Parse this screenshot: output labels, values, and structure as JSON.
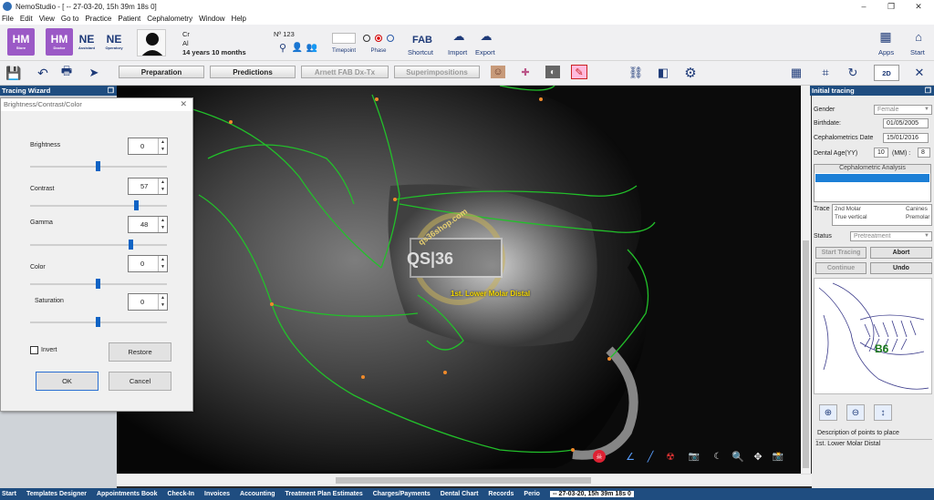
{
  "window": {
    "title": "NemoStudio - [ -- 27-03-20, 15h 39m 18s 0]",
    "minimize": "–",
    "maximize": "❐",
    "close": "✕"
  },
  "menu": [
    "File",
    "Edit",
    "View",
    "Go to",
    "Practice",
    "Patient",
    "Cephalometry",
    "Window",
    "Help"
  ],
  "toolbar": {
    "hm1": {
      "big": "HM",
      "small": "Store"
    },
    "hm2": {
      "big": "HM",
      "small": "Doctor"
    },
    "ne1": {
      "big": "NE",
      "small": "Assistant"
    },
    "ne2": {
      "big": "NE",
      "small": "Operatory"
    },
    "patient": {
      "line1": "Cr",
      "line2": "Al",
      "age": "14 years 10 months",
      "number": "Nº 123"
    },
    "timepoint": "Timepoint",
    "phase": "Phase",
    "fab": {
      "big": "FAB",
      "label": "Shortcut"
    },
    "import": "Import",
    "export": "Export",
    "apps": "Apps",
    "start": "Start"
  },
  "toolbar2": {
    "preparation": "Preparation",
    "predictions": "Predictions",
    "arnett": "Arnett FAB Dx-Tx",
    "superimpositions": "Superimpositions",
    "view2d": "2D"
  },
  "left_panel": {
    "title": "Tracing Wizard"
  },
  "dialog": {
    "title": "Brightness/Contrast/Color",
    "close": "✕",
    "fields": [
      {
        "label": "Brightness",
        "value": "0",
        "slider": 0.5
      },
      {
        "label": "Contrast",
        "value": "57",
        "slider": 0.78
      },
      {
        "label": "Gamma",
        "value": "48",
        "slider": 0.74
      },
      {
        "label": "Color",
        "value": "0",
        "slider": 0.5
      },
      {
        "label": "Saturation",
        "value": "0",
        "slider": 0.5
      }
    ],
    "invert": "Invert",
    "restore": "Restore",
    "ok": "OK",
    "cancel": "Cancel"
  },
  "xray": {
    "label": "1st. Lower Molar Distal",
    "watermark": "qs36shop.com"
  },
  "right_panel": {
    "title": "Initial tracing",
    "gender_label": "Gender",
    "gender": "Female",
    "birthdate_label": "Birthdate:",
    "birthdate": "01/05/2005",
    "ceph_date_label": "Cephalometrics Date",
    "ceph_date": "15/01/2016",
    "dental_age_label": "Dental Age(YY)",
    "dental_age_yy": "10",
    "mm_label": "(MM) :",
    "dental_age_mm": "8",
    "analysis_title": "Cephalometric Analysis",
    "trace_label": "Trace",
    "trace_items": [
      "2nd Molar",
      "Canines",
      "True vertical",
      "Premolar"
    ],
    "status_label": "Status",
    "status": "Pretreatment",
    "start_tracing": "Start Tracing",
    "abort": "Abort",
    "continue": "Continue",
    "undo": "Undo",
    "thumb_label": "B6",
    "desc_title": "Description of points to place",
    "desc_value": "1st. Lower Molar Distal"
  },
  "taskbar": [
    "Start",
    "Templates Designer",
    "Appointments Book",
    "Check-In",
    "Invoices",
    "Accounting",
    "Treatment Plan Estimates",
    "Charges/Payments",
    "Dental Chart",
    "Records",
    "Perio",
    "-- 27-03-20, 15h 39m 18s 0"
  ],
  "taskbar_active": "-- 27-03-20, 15h 39m 18s 0",
  "colors": {
    "accent": "#1f4d80",
    "tracing": "#22c02a",
    "label": "#f5d800",
    "hm": "#9b59c6"
  }
}
